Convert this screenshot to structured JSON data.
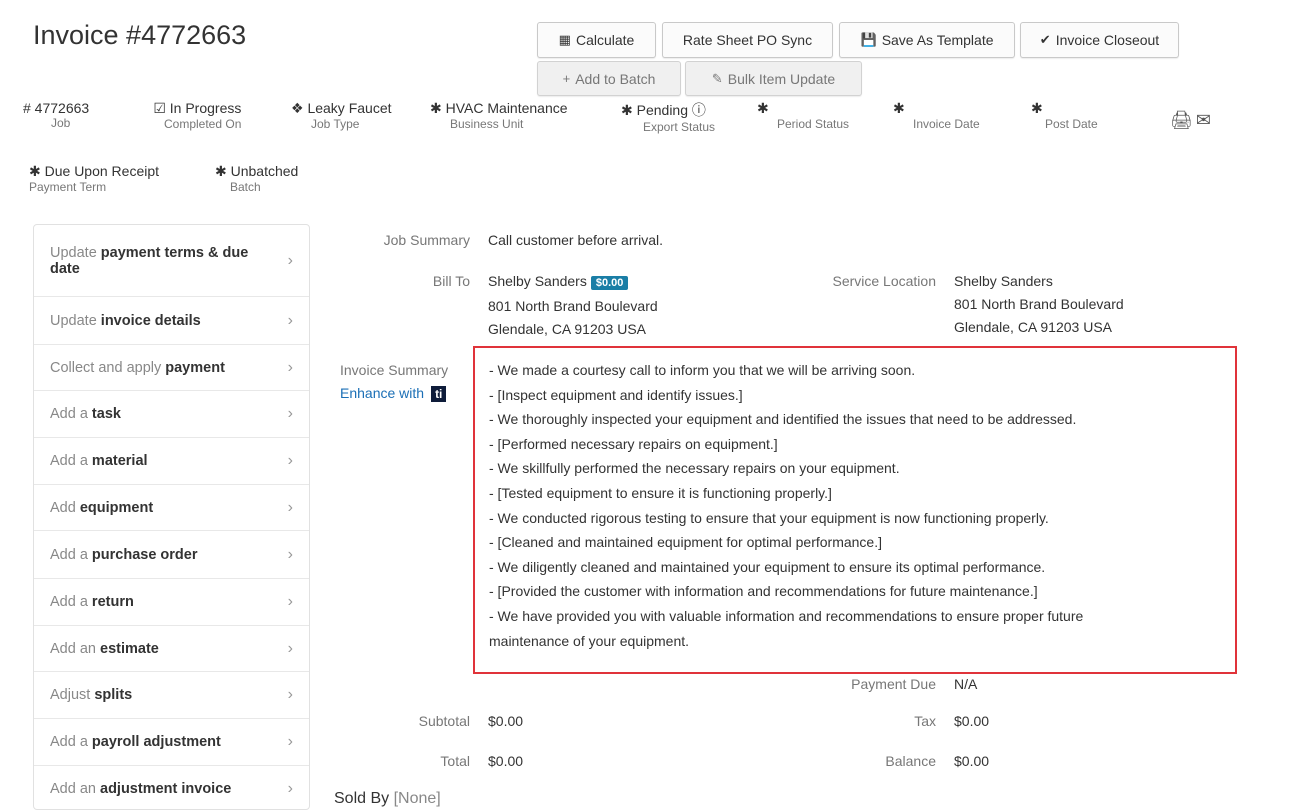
{
  "page": {
    "title": "Invoice #4772663"
  },
  "toolbar": {
    "calculate": "Calculate",
    "rate_sheet": "Rate Sheet PO Sync",
    "save_template": "Save As Template",
    "closeout": "Invoice Closeout",
    "add_batch": "Add to Batch",
    "bulk_update": "Bulk Item Update"
  },
  "meta": {
    "job": {
      "value": "# 4772663",
      "label": "Job"
    },
    "completed": {
      "value": "In Progress",
      "label": "Completed On"
    },
    "job_type": {
      "value": "Leaky Faucet",
      "label": "Job Type"
    },
    "business_unit": {
      "value": "HVAC Maintenance",
      "label": "Business Unit"
    },
    "export_status": {
      "value": "Pending",
      "label": "Export Status"
    },
    "period_status": {
      "value": "",
      "label": "Period Status"
    },
    "invoice_date": {
      "value": "",
      "label": "Invoice Date"
    },
    "post_date": {
      "value": "",
      "label": "Post Date"
    },
    "payment_term": {
      "value": "Due Upon Receipt",
      "label": "Payment Term"
    },
    "batch": {
      "value": "Unbatched",
      "label": "Batch"
    }
  },
  "sidebar": {
    "items": [
      {
        "pre": "Update ",
        "bold": "payment terms & due date",
        "post": ""
      },
      {
        "pre": "Update ",
        "bold": "invoice details",
        "post": ""
      },
      {
        "pre": "Collect and apply ",
        "bold": "payment",
        "post": ""
      },
      {
        "pre": "Add a ",
        "bold": "task",
        "post": ""
      },
      {
        "pre": "Add a ",
        "bold": "material",
        "post": ""
      },
      {
        "pre": "Add ",
        "bold": "equipment",
        "post": ""
      },
      {
        "pre": "Add a ",
        "bold": "purchase order",
        "post": ""
      },
      {
        "pre": "Add a ",
        "bold": "return",
        "post": ""
      },
      {
        "pre": "Add an ",
        "bold": "estimate",
        "post": ""
      },
      {
        "pre": "Adjust ",
        "bold": "splits",
        "post": ""
      },
      {
        "pre": "Add a ",
        "bold": "payroll adjustment",
        "post": ""
      },
      {
        "pre": "Add an ",
        "bold": "adjustment invoice",
        "post": ""
      }
    ]
  },
  "details": {
    "job_summary_label": "Job Summary",
    "job_summary": "Call customer before arrival.",
    "bill_to_label": "Bill To",
    "bill_to_name": "Shelby Sanders",
    "bill_to_badge": "$0.00",
    "bill_to_line1": "801 North Brand Boulevard",
    "bill_to_line2": "Glendale, CA 91203 USA",
    "service_location_label": "Service Location",
    "service_name": "Shelby Sanders",
    "service_line1": "801 North Brand Boulevard",
    "service_line2": "Glendale, CA 91203 USA",
    "invoice_summary_label": "Invoice Summary",
    "enhance_with": "Enhance with",
    "enhance_logo": "ti",
    "summary_lines": [
      "- We made a courtesy call to inform you that we will be arriving soon.",
      "- [Inspect equipment and identify issues.]",
      "- We thoroughly inspected your equipment and identified the issues that need to be addressed.",
      "- [Performed necessary repairs on equipment.]",
      "- We skillfully performed the necessary repairs on your equipment.",
      "- [Tested equipment to ensure it is functioning properly.]",
      "- We conducted rigorous testing to ensure that your equipment is now functioning properly.",
      "- [Cleaned and maintained equipment for optimal performance.]",
      "- We diligently cleaned and maintained your equipment to ensure its optimal performance.",
      "- [Provided the customer with information and recommendations for future maintenance.]",
      "- We have provided you with valuable information and recommendations to ensure proper future",
      "maintenance of your equipment."
    ],
    "payment_due_label": "Payment Due",
    "payment_due": "N/A",
    "subtotal_label": "Subtotal",
    "subtotal": "$0.00",
    "tax_label": "Tax",
    "tax": "$0.00",
    "total_label": "Total",
    "total": "$0.00",
    "balance_label": "Balance",
    "balance": "$0.00",
    "sold_by_label": "Sold By",
    "sold_by": "[None]"
  },
  "icons": {
    "calculate": "calculator-icon",
    "save": "floppy-icon",
    "closeout": "double-check-icon",
    "add": "plus-icon",
    "bulk": "pencil-icon",
    "print": "printer-icon",
    "mail": "envelope-icon",
    "info": "info-icon",
    "chevron": "chevron-right-icon"
  },
  "colors": {
    "highlight_border": "#e0333a",
    "badge": "#1a7ea6",
    "link": "#1b6fb6"
  }
}
